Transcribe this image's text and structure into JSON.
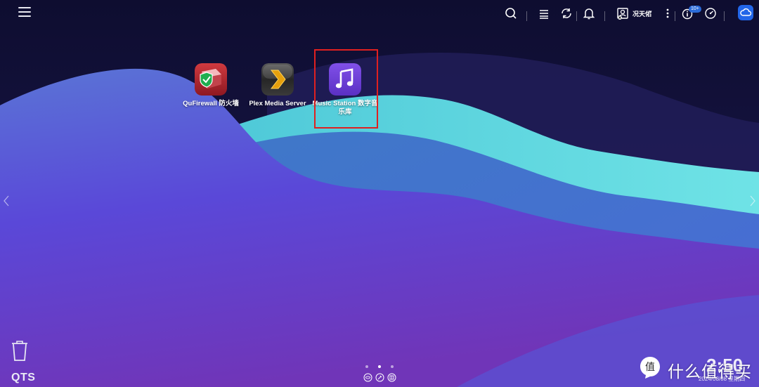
{
  "topbar": {
    "user_name": "况天佑",
    "notification_badge": "10+"
  },
  "apps": [
    {
      "label": "QuFirewall 防火墙"
    },
    {
      "label": "Plex Media Server"
    },
    {
      "label": "Music Station 数字音乐库"
    }
  ],
  "desktop": {
    "brand": "QTS",
    "clock": "2:50",
    "date": "2024/08/08 星期四",
    "pages_total": 3,
    "active_page": 2
  },
  "watermark": {
    "text": "什么值得买",
    "logo_char": "值"
  },
  "colors": {
    "accent_blue": "#2266e8",
    "highlight_red": "#e02020",
    "music_purple": "#6a3fd6",
    "firewall_red": "#b3212b",
    "plex_gold": "#e5a00d"
  }
}
